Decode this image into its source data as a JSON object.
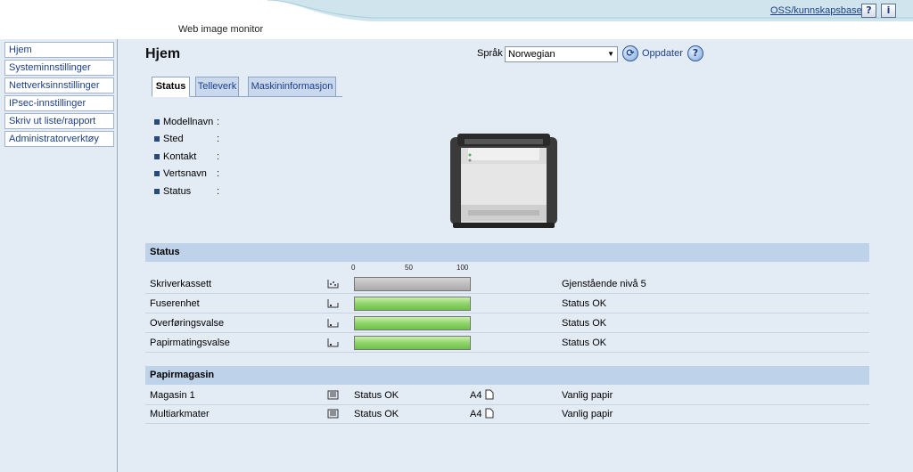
{
  "header": {
    "app_title": "Web image monitor",
    "kb_link": "OSS/kunnskapsbase",
    "help_button": "?",
    "info_button": "i"
  },
  "sidebar": {
    "items": [
      {
        "label": "Hjem"
      },
      {
        "label": "Systeminnstillinger"
      },
      {
        "label": "Nettverksinnstillinger"
      },
      {
        "label": "IPsec-innstillinger"
      },
      {
        "label": "Skriv ut liste/rapport"
      },
      {
        "label": "Administratorverktøy"
      }
    ]
  },
  "main": {
    "title": "Hjem",
    "language_label": "Språk",
    "language_value": "Norwegian",
    "refresh_label": "Oppdater",
    "help_icon": "?"
  },
  "tabs": [
    {
      "label": "Status",
      "active": true
    },
    {
      "label": "Telleverk",
      "active": false
    },
    {
      "label": "Maskininformasjon",
      "active": false
    }
  ],
  "info": [
    {
      "label": "Modellnavn",
      "sep": ":"
    },
    {
      "label": "Sted",
      "sep": ":"
    },
    {
      "label": "Kontakt",
      "sep": ":"
    },
    {
      "label": "Vertsnavn",
      "sep": ":"
    },
    {
      "label": "Status",
      "sep": ":"
    }
  ],
  "status_section": {
    "title": "Status",
    "scale": [
      "0",
      "50",
      "100"
    ],
    "rows": [
      {
        "name": "Skriverkassett",
        "level": 1.0,
        "color": "#b8b8b8",
        "status": "Gjenstående nivå 5"
      },
      {
        "name": "Fuserenhet",
        "level": 1.0,
        "color": "#8fd46b",
        "status": "Status OK"
      },
      {
        "name": "Overføringsvalse",
        "level": 1.0,
        "color": "#8fd46b",
        "status": "Status OK"
      },
      {
        "name": "Papirmatingsvalse",
        "level": 1.0,
        "color": "#8fd46b",
        "status": "Status OK"
      }
    ]
  },
  "tray_section": {
    "title": "Papirmagasin",
    "rows": [
      {
        "name": "Magasin 1",
        "status": "Status OK",
        "size": "A4",
        "type": "Vanlig papir"
      },
      {
        "name": "Multiarkmater",
        "status": "Status OK",
        "size": "A4",
        "type": "Vanlig papir"
      }
    ]
  }
}
